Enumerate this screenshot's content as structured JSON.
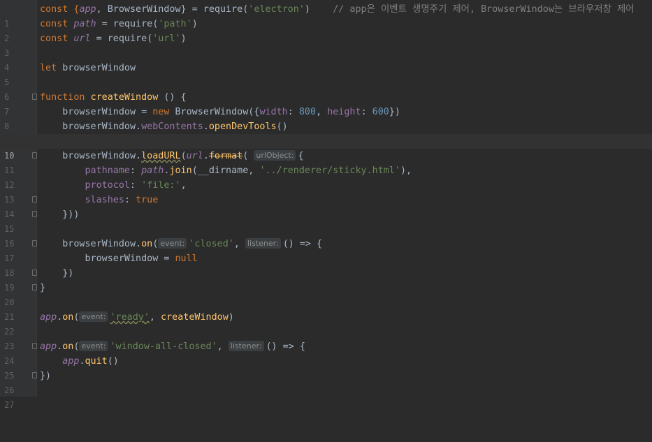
{
  "lines": [
    {
      "n": "1"
    },
    {
      "n": "2"
    },
    {
      "n": "3"
    },
    {
      "n": "4"
    },
    {
      "n": "5"
    },
    {
      "n": "6"
    },
    {
      "n": "7"
    },
    {
      "n": "8"
    },
    {
      "n": "9"
    },
    {
      "n": "10"
    },
    {
      "n": "11"
    },
    {
      "n": "12"
    },
    {
      "n": "13"
    },
    {
      "n": "14"
    },
    {
      "n": "15"
    },
    {
      "n": "16"
    },
    {
      "n": "17"
    },
    {
      "n": "18"
    },
    {
      "n": "19"
    },
    {
      "n": "20"
    },
    {
      "n": "21"
    },
    {
      "n": "22"
    },
    {
      "n": "23"
    },
    {
      "n": "24"
    },
    {
      "n": "25"
    },
    {
      "n": "26"
    },
    {
      "n": "27"
    }
  ],
  "code": {
    "l1": {
      "a": "const {",
      "b": "app",
      "c": ", BrowserWindow} = require(",
      "d": "'electron'",
      "e": ")    ",
      "f": "// app은 이벤트 생명주기 제어, BrowserWindow는 브라우저창 제어"
    },
    "l2": {
      "a": "const ",
      "b": "path",
      "c": " = require(",
      "d": "'path'",
      "e": ")"
    },
    "l3": {
      "a": "const ",
      "b": "url",
      "c": " = require(",
      "d": "'url'",
      "e": ")"
    },
    "l5": {
      "a": "let ",
      "b": "browserWindow"
    },
    "l7": {
      "a": "function ",
      "b": "createWindow",
      "c": " () {"
    },
    "l8": {
      "a": "    browserWindow = ",
      "b": "new ",
      "c": "BrowserWindow({",
      "d": "width",
      "e": ": ",
      "f": "800",
      "g": ", ",
      "h": "height",
      "i": ": ",
      "j": "600",
      "k": "})"
    },
    "l9": {
      "a": "    browserWindow.",
      "b": "webContents",
      "c": ".",
      "d": "openDevTools",
      "e": "()"
    },
    "l11": {
      "a": "    browserWindow.",
      "b": "loadURL",
      "c": "(",
      "d": "url",
      "e": ".",
      "f": "format",
      "g": "(",
      "h": "urlObject:",
      "i": "{"
    },
    "l12": {
      "a": "        ",
      "b": "pathname",
      "c": ": ",
      "d": "path",
      "e": ".",
      "f": "join",
      "g": "(__dirname, ",
      "h": "'../renderer/sticky.html'",
      "i": "),"
    },
    "l13": {
      "a": "        ",
      "b": "protocol",
      "c": ": ",
      "d": "'file:'",
      "e": ","
    },
    "l14": {
      "a": "        ",
      "b": "slashes",
      "c": ": ",
      "d": "true"
    },
    "l15": {
      "a": "    }))"
    },
    "l17": {
      "a": "    browserWindow.",
      "b": "on",
      "c": "(",
      "d": "event:",
      "e": "'closed'",
      "f": ", ",
      "g": "listener:",
      "h": "() => {"
    },
    "l18": {
      "a": "        browserWindow = ",
      "b": "null"
    },
    "l19": {
      "a": "    })"
    },
    "l20": {
      "a": "}"
    },
    "l22": {
      "a": "app",
      "b": ".",
      "c": "on",
      "d": "(",
      "e": "event:",
      "f": "'ready'",
      "g": ", ",
      "h": "createWindow",
      "i": ")"
    },
    "l24": {
      "a": "app",
      "b": ".",
      "c": "on",
      "d": "(",
      "e": "event:",
      "f": "'window-all-closed'",
      "g": ", ",
      "h": "listener:",
      "i": "() => {"
    },
    "l25": {
      "a": "    ",
      "b": "app",
      "c": ".",
      "d": "quit",
      "e": "()"
    },
    "l26": {
      "a": "})"
    }
  },
  "colors": {
    "background": "#2b2b2b",
    "keyword": "#cc7832",
    "string": "#6a8759",
    "number": "#6897bb",
    "function": "#ffc66d",
    "property": "#9876aa",
    "comment": "#808080"
  }
}
